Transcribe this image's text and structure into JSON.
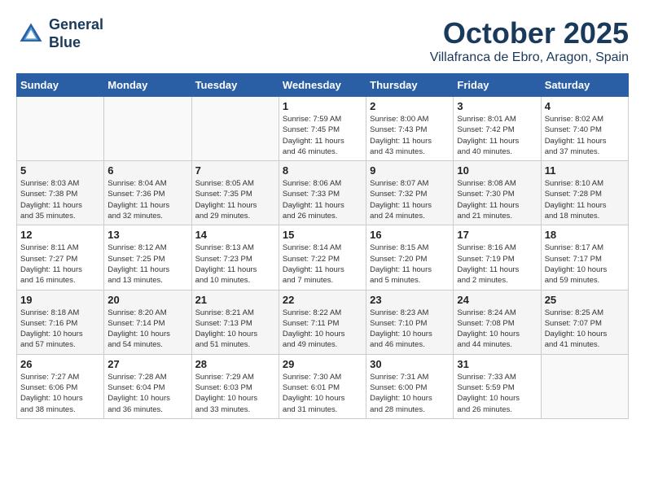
{
  "header": {
    "logo_line1": "General",
    "logo_line2": "Blue",
    "month": "October 2025",
    "location": "Villafranca de Ebro, Aragon, Spain"
  },
  "weekdays": [
    "Sunday",
    "Monday",
    "Tuesday",
    "Wednesday",
    "Thursday",
    "Friday",
    "Saturday"
  ],
  "weeks": [
    [
      {
        "day": "",
        "info": ""
      },
      {
        "day": "",
        "info": ""
      },
      {
        "day": "",
        "info": ""
      },
      {
        "day": "1",
        "info": "Sunrise: 7:59 AM\nSunset: 7:45 PM\nDaylight: 11 hours\nand 46 minutes."
      },
      {
        "day": "2",
        "info": "Sunrise: 8:00 AM\nSunset: 7:43 PM\nDaylight: 11 hours\nand 43 minutes."
      },
      {
        "day": "3",
        "info": "Sunrise: 8:01 AM\nSunset: 7:42 PM\nDaylight: 11 hours\nand 40 minutes."
      },
      {
        "day": "4",
        "info": "Sunrise: 8:02 AM\nSunset: 7:40 PM\nDaylight: 11 hours\nand 37 minutes."
      }
    ],
    [
      {
        "day": "5",
        "info": "Sunrise: 8:03 AM\nSunset: 7:38 PM\nDaylight: 11 hours\nand 35 minutes."
      },
      {
        "day": "6",
        "info": "Sunrise: 8:04 AM\nSunset: 7:36 PM\nDaylight: 11 hours\nand 32 minutes."
      },
      {
        "day": "7",
        "info": "Sunrise: 8:05 AM\nSunset: 7:35 PM\nDaylight: 11 hours\nand 29 minutes."
      },
      {
        "day": "8",
        "info": "Sunrise: 8:06 AM\nSunset: 7:33 PM\nDaylight: 11 hours\nand 26 minutes."
      },
      {
        "day": "9",
        "info": "Sunrise: 8:07 AM\nSunset: 7:32 PM\nDaylight: 11 hours\nand 24 minutes."
      },
      {
        "day": "10",
        "info": "Sunrise: 8:08 AM\nSunset: 7:30 PM\nDaylight: 11 hours\nand 21 minutes."
      },
      {
        "day": "11",
        "info": "Sunrise: 8:10 AM\nSunset: 7:28 PM\nDaylight: 11 hours\nand 18 minutes."
      }
    ],
    [
      {
        "day": "12",
        "info": "Sunrise: 8:11 AM\nSunset: 7:27 PM\nDaylight: 11 hours\nand 16 minutes."
      },
      {
        "day": "13",
        "info": "Sunrise: 8:12 AM\nSunset: 7:25 PM\nDaylight: 11 hours\nand 13 minutes."
      },
      {
        "day": "14",
        "info": "Sunrise: 8:13 AM\nSunset: 7:23 PM\nDaylight: 11 hours\nand 10 minutes."
      },
      {
        "day": "15",
        "info": "Sunrise: 8:14 AM\nSunset: 7:22 PM\nDaylight: 11 hours\nand 7 minutes."
      },
      {
        "day": "16",
        "info": "Sunrise: 8:15 AM\nSunset: 7:20 PM\nDaylight: 11 hours\nand 5 minutes."
      },
      {
        "day": "17",
        "info": "Sunrise: 8:16 AM\nSunset: 7:19 PM\nDaylight: 11 hours\nand 2 minutes."
      },
      {
        "day": "18",
        "info": "Sunrise: 8:17 AM\nSunset: 7:17 PM\nDaylight: 10 hours\nand 59 minutes."
      }
    ],
    [
      {
        "day": "19",
        "info": "Sunrise: 8:18 AM\nSunset: 7:16 PM\nDaylight: 10 hours\nand 57 minutes."
      },
      {
        "day": "20",
        "info": "Sunrise: 8:20 AM\nSunset: 7:14 PM\nDaylight: 10 hours\nand 54 minutes."
      },
      {
        "day": "21",
        "info": "Sunrise: 8:21 AM\nSunset: 7:13 PM\nDaylight: 10 hours\nand 51 minutes."
      },
      {
        "day": "22",
        "info": "Sunrise: 8:22 AM\nSunset: 7:11 PM\nDaylight: 10 hours\nand 49 minutes."
      },
      {
        "day": "23",
        "info": "Sunrise: 8:23 AM\nSunset: 7:10 PM\nDaylight: 10 hours\nand 46 minutes."
      },
      {
        "day": "24",
        "info": "Sunrise: 8:24 AM\nSunset: 7:08 PM\nDaylight: 10 hours\nand 44 minutes."
      },
      {
        "day": "25",
        "info": "Sunrise: 8:25 AM\nSunset: 7:07 PM\nDaylight: 10 hours\nand 41 minutes."
      }
    ],
    [
      {
        "day": "26",
        "info": "Sunrise: 7:27 AM\nSunset: 6:06 PM\nDaylight: 10 hours\nand 38 minutes."
      },
      {
        "day": "27",
        "info": "Sunrise: 7:28 AM\nSunset: 6:04 PM\nDaylight: 10 hours\nand 36 minutes."
      },
      {
        "day": "28",
        "info": "Sunrise: 7:29 AM\nSunset: 6:03 PM\nDaylight: 10 hours\nand 33 minutes."
      },
      {
        "day": "29",
        "info": "Sunrise: 7:30 AM\nSunset: 6:01 PM\nDaylight: 10 hours\nand 31 minutes."
      },
      {
        "day": "30",
        "info": "Sunrise: 7:31 AM\nSunset: 6:00 PM\nDaylight: 10 hours\nand 28 minutes."
      },
      {
        "day": "31",
        "info": "Sunrise: 7:33 AM\nSunset: 5:59 PM\nDaylight: 10 hours\nand 26 minutes."
      },
      {
        "day": "",
        "info": ""
      }
    ]
  ]
}
